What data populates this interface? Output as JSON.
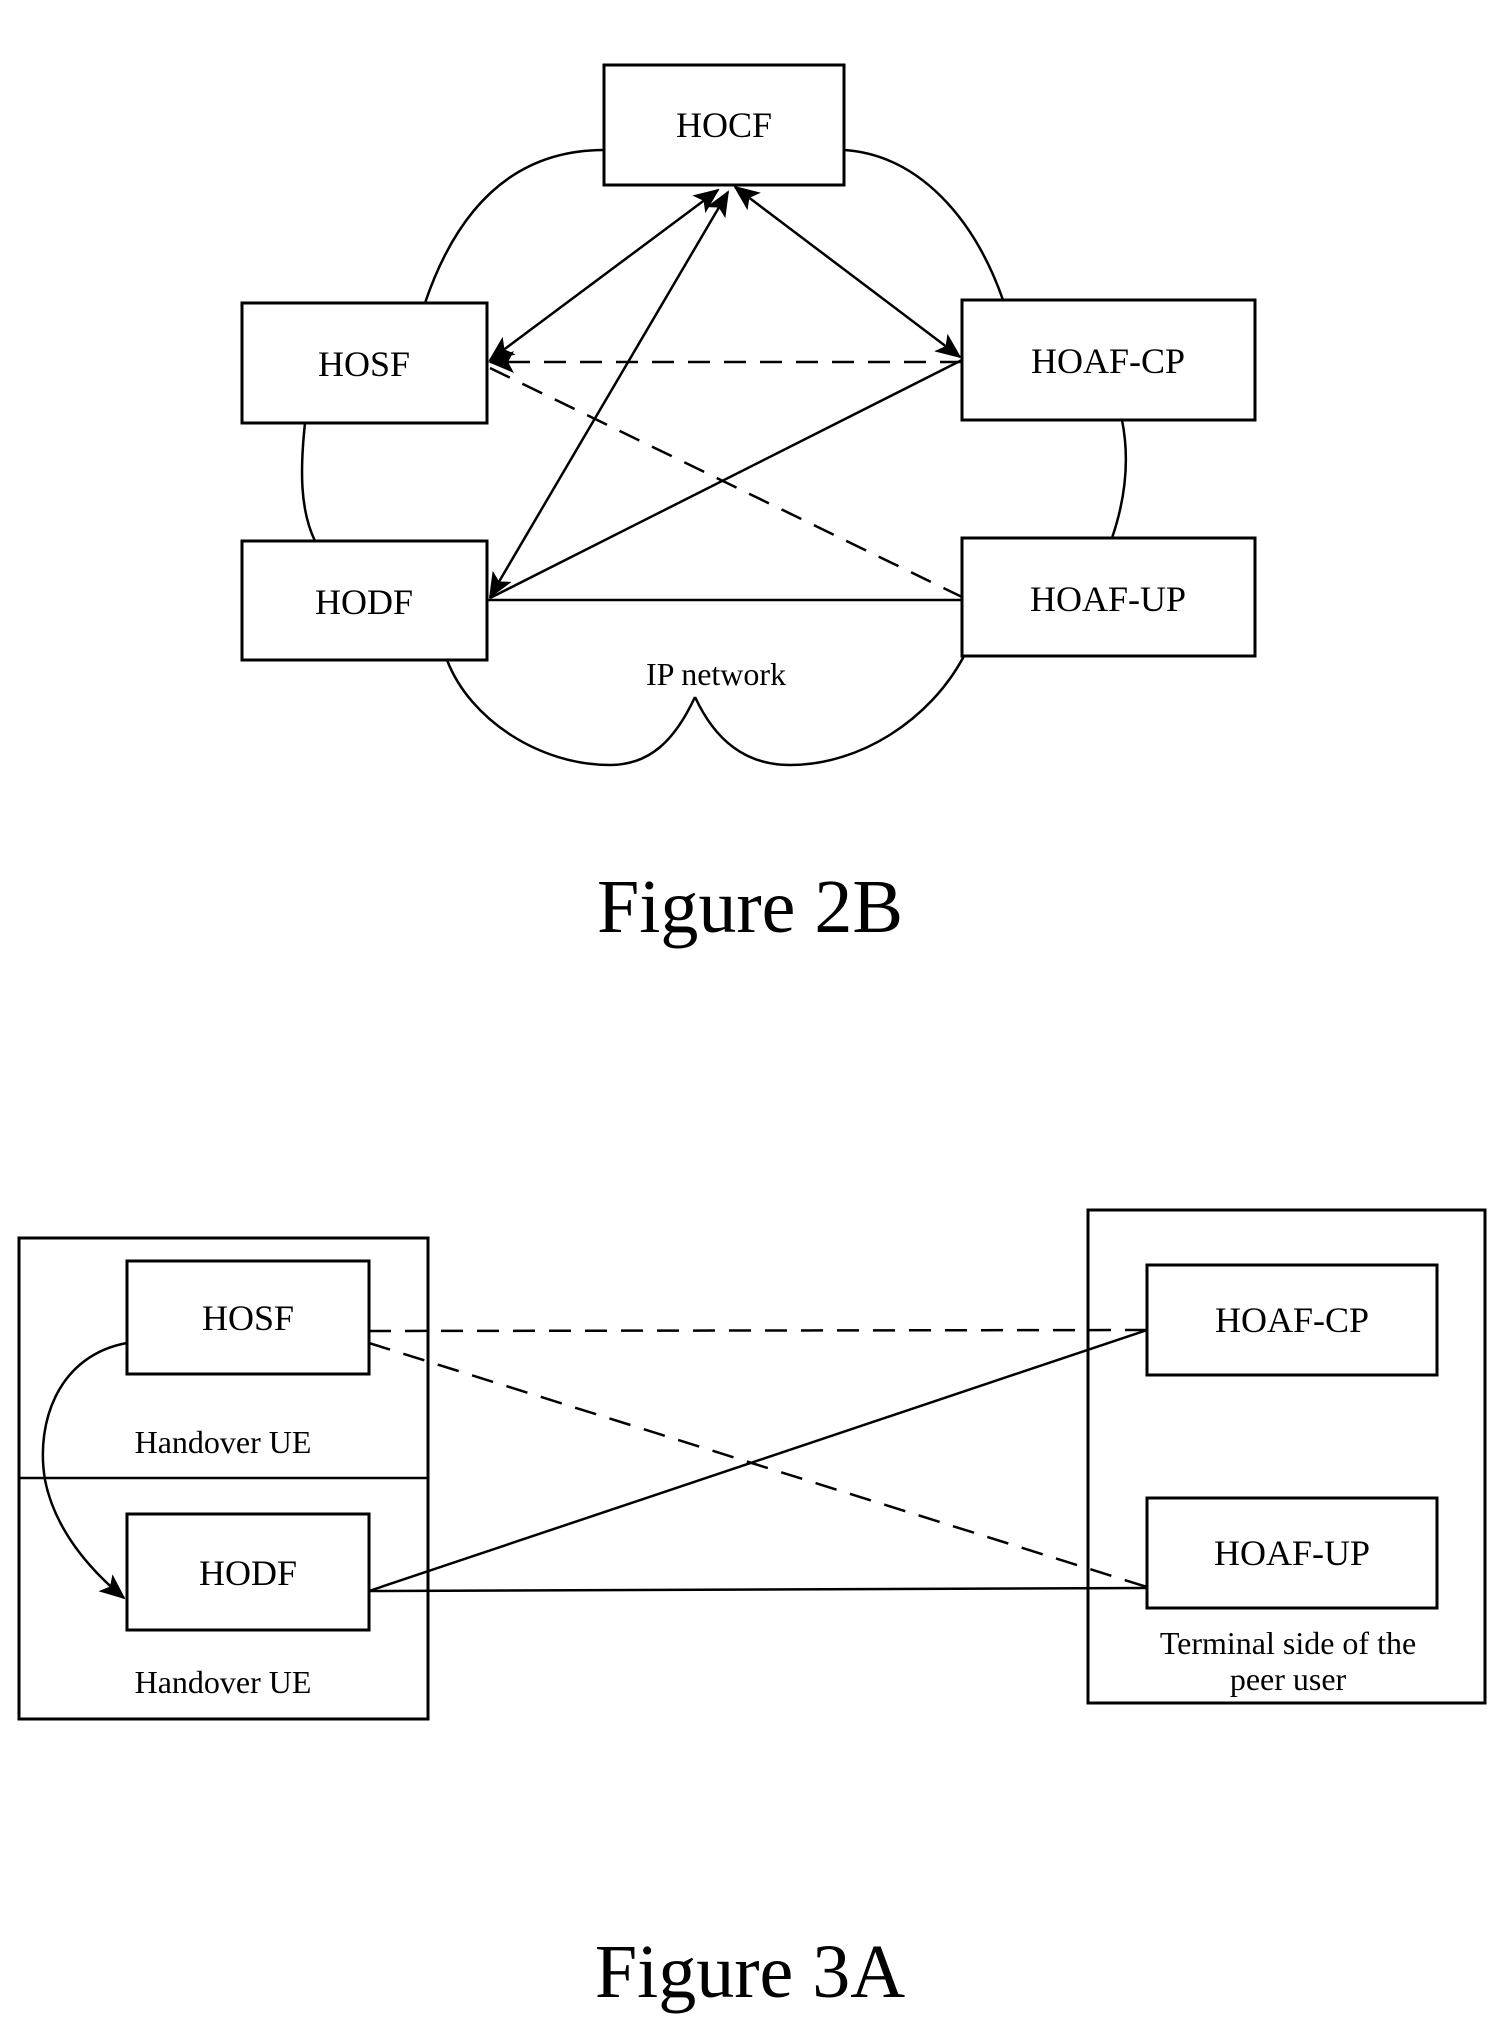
{
  "figure_2b": {
    "caption": "Figure 2B",
    "network_label": "IP network",
    "nodes": {
      "hocf": "HOCF",
      "hosf": "HOSF",
      "hodf": "HODF",
      "hoaf_cp": "HOAF-CP",
      "hoaf_up": "HOAF-UP"
    },
    "connections": [
      {
        "from": "HOCF",
        "to": "HOSF",
        "style": "solid",
        "arrows": "both"
      },
      {
        "from": "HOCF",
        "to": "HODF",
        "style": "solid",
        "arrows": "both"
      },
      {
        "from": "HOCF",
        "to": "HOAF-CP",
        "style": "solid",
        "arrows": "both"
      },
      {
        "from": "HOSF",
        "to": "HOAF-CP",
        "style": "dashed",
        "arrows": "both"
      },
      {
        "from": "HOSF",
        "to": "HOAF-UP",
        "style": "dashed",
        "arrows": "none"
      },
      {
        "from": "HODF",
        "to": "HOAF-CP",
        "style": "solid",
        "arrows": "none"
      },
      {
        "from": "HODF",
        "to": "HOAF-UP",
        "style": "solid",
        "arrows": "none"
      }
    ]
  },
  "figure_3a": {
    "caption": "Figure 3A",
    "left_group": {
      "upper_label": "Handover UE",
      "lower_label": "Handover UE"
    },
    "right_group": {
      "label_line1": "Terminal side of the",
      "label_line2": "peer user"
    },
    "nodes": {
      "hosf": "HOSF",
      "hodf": "HODF",
      "hoaf_cp": "HOAF-CP",
      "hoaf_up": "HOAF-UP"
    },
    "connections": [
      {
        "from": "HOSF",
        "to": "HODF",
        "style": "solid-curved",
        "arrows": "end"
      },
      {
        "from": "HOSF",
        "to": "HOAF-CP",
        "style": "dashed",
        "arrows": "none"
      },
      {
        "from": "HOSF",
        "to": "HOAF-UP",
        "style": "dashed",
        "arrows": "none"
      },
      {
        "from": "HODF",
        "to": "HOAF-CP",
        "style": "solid",
        "arrows": "none"
      },
      {
        "from": "HODF",
        "to": "HOAF-UP",
        "style": "solid",
        "arrows": "none"
      }
    ]
  }
}
